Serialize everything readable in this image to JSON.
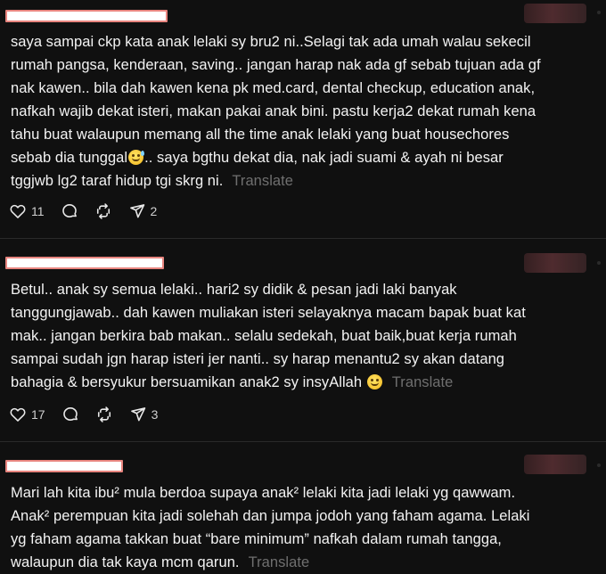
{
  "posts": [
    {
      "lines": [
        "saya sampai ckp kata anak lelaki sy bru2 ni..Selagi tak ada umah walau sekecil",
        "rumah pangsa, kenderaan, saving.. jangan harap nak ada gf sebab tujuan ada gf",
        "nak kawen.. bila dah kawen kena pk med.card, dental checkup, education anak,",
        "nafkah wajib dekat isteri, makan pakai anak bini. pastu kerja2 dekat rumah kena",
        "tahu buat walaupun memang all the time anak lelaki yang buat housechores",
        "sebab dia tunggal",
        ".. saya bgthu dekat dia, nak jadi suami & ayah ni besar",
        "tggjwb lg2 taraf hidup tgi skrg ni."
      ],
      "emoji": "grinning-sweat-emoji",
      "translate": "Translate",
      "likes": "11",
      "shares": "2"
    },
    {
      "lines": [
        "Betul.. anak sy semua lelaki.. hari2 sy didik & pesan jadi laki banyak",
        "tanggungjawab.. dah kawen muliakan isteri selayaknya macam bapak buat kat",
        "mak.. jangan berkira bab makan.. selalu sedekah, buat baik,buat kerja rumah",
        "sampai sudah jgn harap isteri jer nanti.. sy harap menantu2 sy akan datang",
        "bahagia & bersyukur bersuamikan anak2 sy insyAllah"
      ],
      "emoji": "smiling-emoji",
      "translate": "Translate",
      "likes": "17",
      "shares": "3"
    },
    {
      "lines": [
        "Mari lah kita ibu² mula berdoa supaya anak² lelaki kita jadi lelaki yg qawwam.",
        "Anak² perempuan kita jadi solehah dan jumpa jodoh yang faham agama. Lelaki",
        "yg faham agama takkan buat “bare minimum” nafkah dalam rumah tangga,",
        "walaupun dia tak kaya mcm qarun."
      ],
      "translate": "Translate"
    }
  ]
}
